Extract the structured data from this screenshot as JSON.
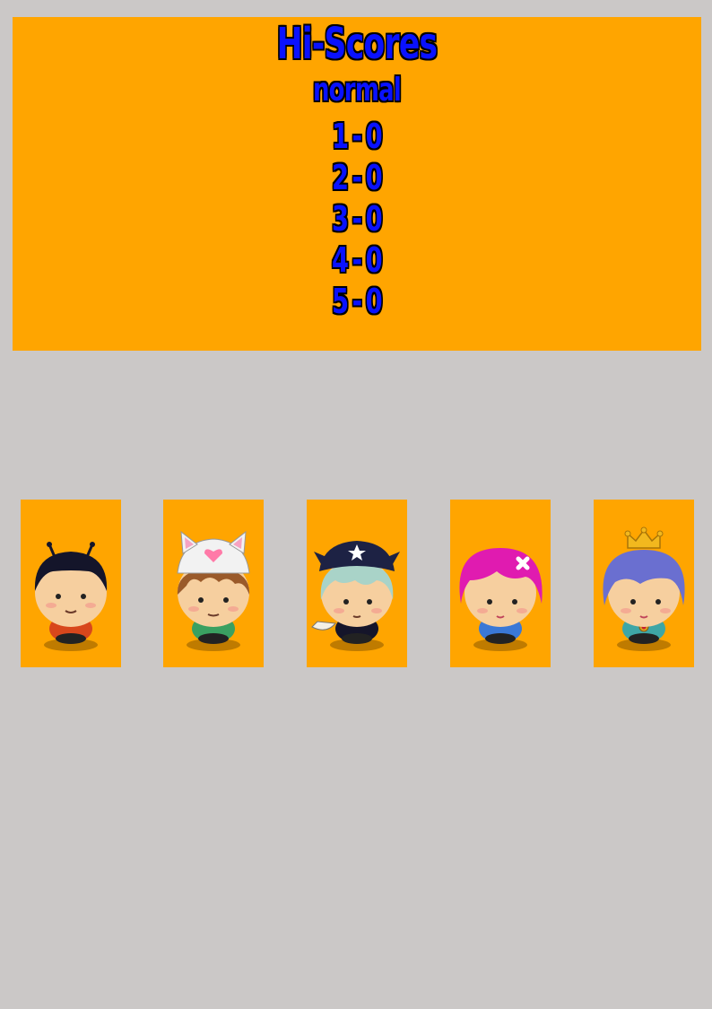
{
  "hiscores": {
    "title": "Hi-Scores",
    "mode": "normal",
    "entries": [
      {
        "rank": "1",
        "score": "0"
      },
      {
        "rank": "2",
        "score": "0"
      },
      {
        "rank": "3",
        "score": "0"
      },
      {
        "rank": "4",
        "score": "0"
      },
      {
        "rank": "5",
        "score": "0"
      }
    ]
  },
  "colors": {
    "background": "#cbc8c7",
    "panel": "#ffa500",
    "score_text": "#0a12ff",
    "outline": "#000000"
  },
  "characters": [
    {
      "icon": "bug-antenna-boy-icon",
      "hair": "#14152a",
      "shirt": "#d8471c"
    },
    {
      "icon": "cat-hat-girl-icon",
      "hair": "#9a5a2a",
      "shirt": "#3aa061"
    },
    {
      "icon": "pirate-bandana-icon",
      "hair": "#a9d3c8",
      "shirt": "#15152a"
    },
    {
      "icon": "pink-hair-girl-icon",
      "hair": "#e01bb0",
      "shirt": "#3a78d6"
    },
    {
      "icon": "crowned-princess-icon",
      "hair": "#6a6fd0",
      "shirt": "#3ea6a6"
    }
  ]
}
